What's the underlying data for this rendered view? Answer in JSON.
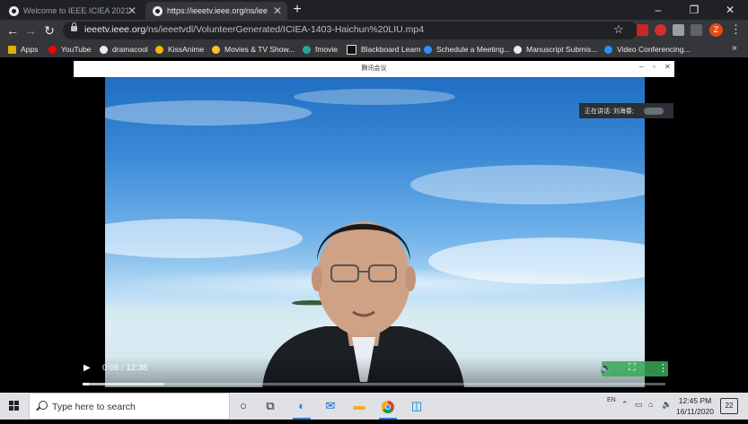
{
  "browser": {
    "tabs": [
      {
        "title": "Welcome to IEEE ICIEA 2021",
        "active": false
      },
      {
        "title": "https://ieeetv.ieee.org/ns/iee",
        "active": true
      }
    ],
    "url_host": "ieeetv.ieee.org",
    "url_path": "/ns/ieeetvdl/VolunteerGenerated/ICIEA-1403-Haichun%20LIU.mp4",
    "profile_initial": "Z",
    "bookmarks": [
      "Apps",
      "YouTube",
      "dramacool",
      "KissAnime",
      "Movies & TV Show...",
      "fmovie",
      "Blackboard Learn",
      "Schedule a Meeting...",
      "Manuscript Submis...",
      "Video Conferencing..."
    ],
    "bookmarks_more": "»"
  },
  "meeting": {
    "window_title": "腾讯会议",
    "speaker_label": "正在讲话: 刘海春;"
  },
  "video": {
    "current_time": "0:08",
    "duration": "12:38",
    "progress": 0.0106,
    "buffered": 0.14
  },
  "taskbar": {
    "search_placeholder": "Type here to search",
    "time": "12:45 PM",
    "date": "16/11/2020",
    "lang": "EN",
    "notifications": "22"
  },
  "colors": {
    "browser_dark": "#202124",
    "toolbar": "#35363a",
    "taskbar": "#dfe1e5",
    "sky": "#3b8ad6",
    "profile": "#e64a19"
  }
}
